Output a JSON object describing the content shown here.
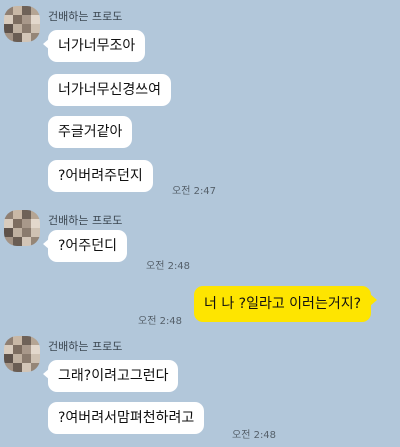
{
  "groups": [
    {
      "sender": "건배하는 프로도",
      "messages": [
        "너가너무조아",
        "너가너무신경쓰여",
        "주글거같아",
        "?어버려주던지"
      ],
      "time": "오전 2:47"
    },
    {
      "sender": "건배하는 프로도",
      "messages": [
        "?어주던디"
      ],
      "time": "오전 2:48"
    },
    {
      "mine": true,
      "messages": [
        "너 나 ?일라고 이러는거지?"
      ],
      "time": "오전 2:48"
    },
    {
      "sender": "건배하는 프로도",
      "messages": [
        "그래?이려고그런다",
        "?여버려서맘펴천하려고"
      ],
      "time": "오전 2:48"
    }
  ]
}
